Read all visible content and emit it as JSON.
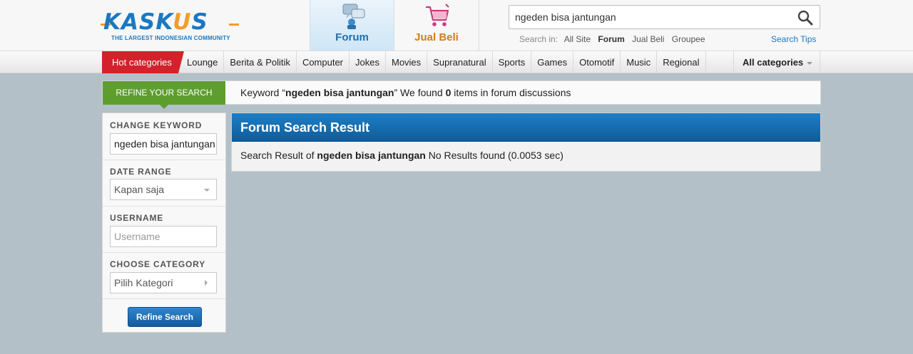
{
  "header": {
    "logo": {
      "word_left": "KASK",
      "word_accent": "U",
      "word_right": "S",
      "tagline": "THE LARGEST INDONESIAN COMMUNITY"
    },
    "tabs": [
      {
        "label": "Forum",
        "icon": "forum-icon",
        "active": true
      },
      {
        "label": "Jual Beli",
        "icon": "shopping-cart-icon",
        "active": false
      }
    ],
    "search": {
      "value": "ngeden bisa jantungan",
      "search_in_label": "Search in:",
      "options": [
        "All Site",
        "Forum",
        "Jual Beli",
        "Groupee"
      ],
      "active_option": "Forum",
      "tips_label": "Search Tips"
    }
  },
  "categories": {
    "hot_label": "Hot categories",
    "items": [
      "Lounge",
      "Berita & Politik",
      "Computer",
      "Jokes",
      "Movies",
      "Supranatural",
      "Sports",
      "Games",
      "Otomotif",
      "Music",
      "Regional"
    ],
    "all_label": "All categories"
  },
  "refine_bar": {
    "label": "REFINE YOUR SEARCH",
    "msg_prefix": "Keyword “",
    "keyword": "ngeden bisa jantungan",
    "msg_middle": "” We found ",
    "count": "0",
    "msg_suffix": " items in forum discussions"
  },
  "sidebar": {
    "change_keyword_title": "CHANGE KEYWORD",
    "keyword_value": "ngeden bisa jantungan",
    "date_range_title": "DATE RANGE",
    "date_range_value": "Kapan saja",
    "username_title": "USERNAME",
    "username_placeholder": "Username",
    "category_title": "CHOOSE CATEGORY",
    "category_value": "Pilih Kategori",
    "refine_button": "Refine Search"
  },
  "result": {
    "title": "Forum Search Result",
    "prefix": "Search Result of ",
    "keyword": "ngeden bisa jantungan",
    "suffix": " No Results found (0.0053 sec)"
  },
  "colors": {
    "brand_blue": "#1a78c2",
    "brand_orange": "#f39c2d",
    "hot_red": "#d3222b",
    "refine_green": "#5e9e2e",
    "page_bg": "#b3c0c8"
  }
}
